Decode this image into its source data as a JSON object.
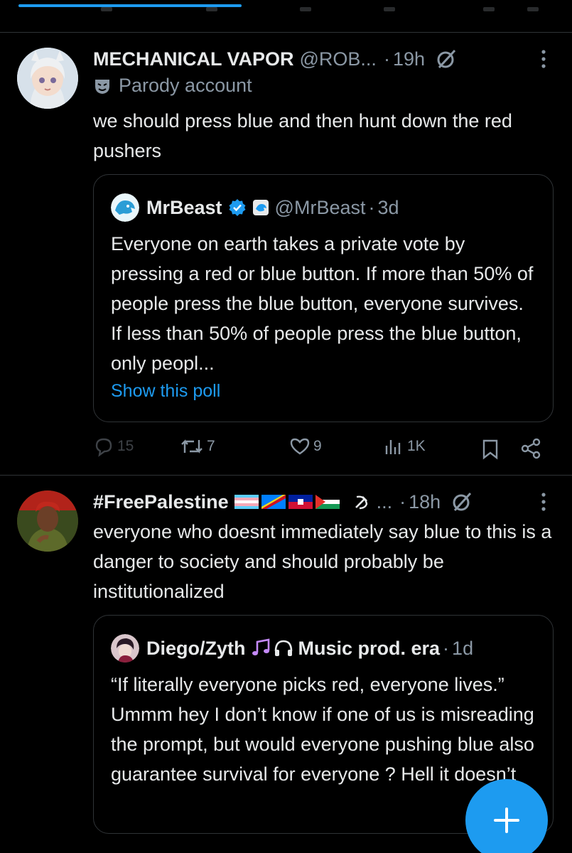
{
  "colors": {
    "background": "#000000",
    "accent": "#1d9bf0",
    "muted": "#8b98a5",
    "divider": "#2f3336"
  },
  "tweets": [
    {
      "name": "MECHANICAL VAPOR",
      "handle": "@ROB...",
      "time": "19h",
      "label": "Parody account",
      "text": "we should press blue and then hunt down the red pushers",
      "quote": {
        "name": "MrBeast",
        "handle": "@MrBeast",
        "time": "3d",
        "text": "Everyone on earth takes a private vote by pressing a red or blue button. If more than 50% of people press the blue button, everyone survives. If less than 50% of people press the blue button, only peopl...",
        "link": "Show this poll"
      },
      "stats": {
        "replies": "15",
        "reposts": "7",
        "likes": "9",
        "views": "1K"
      }
    },
    {
      "name": "#FreePalestine",
      "name_suffix": "...",
      "time": "18h",
      "text": "everyone who doesnt immediately say blue to this is a danger to society and should probably be institutionalized",
      "quote": {
        "name": "Diego/Zyth",
        "name_suffix": "Music prod. era",
        "time": "1d",
        "text": "“If literally everyone picks red, everyone lives.” Ummm hey I don’t know if one of us is misreading the prompt, but would everyone pushing blue also guarantee survival for everyone ? Hell it doesn’t"
      }
    }
  ],
  "fab": {
    "icon": "plus-icon"
  }
}
